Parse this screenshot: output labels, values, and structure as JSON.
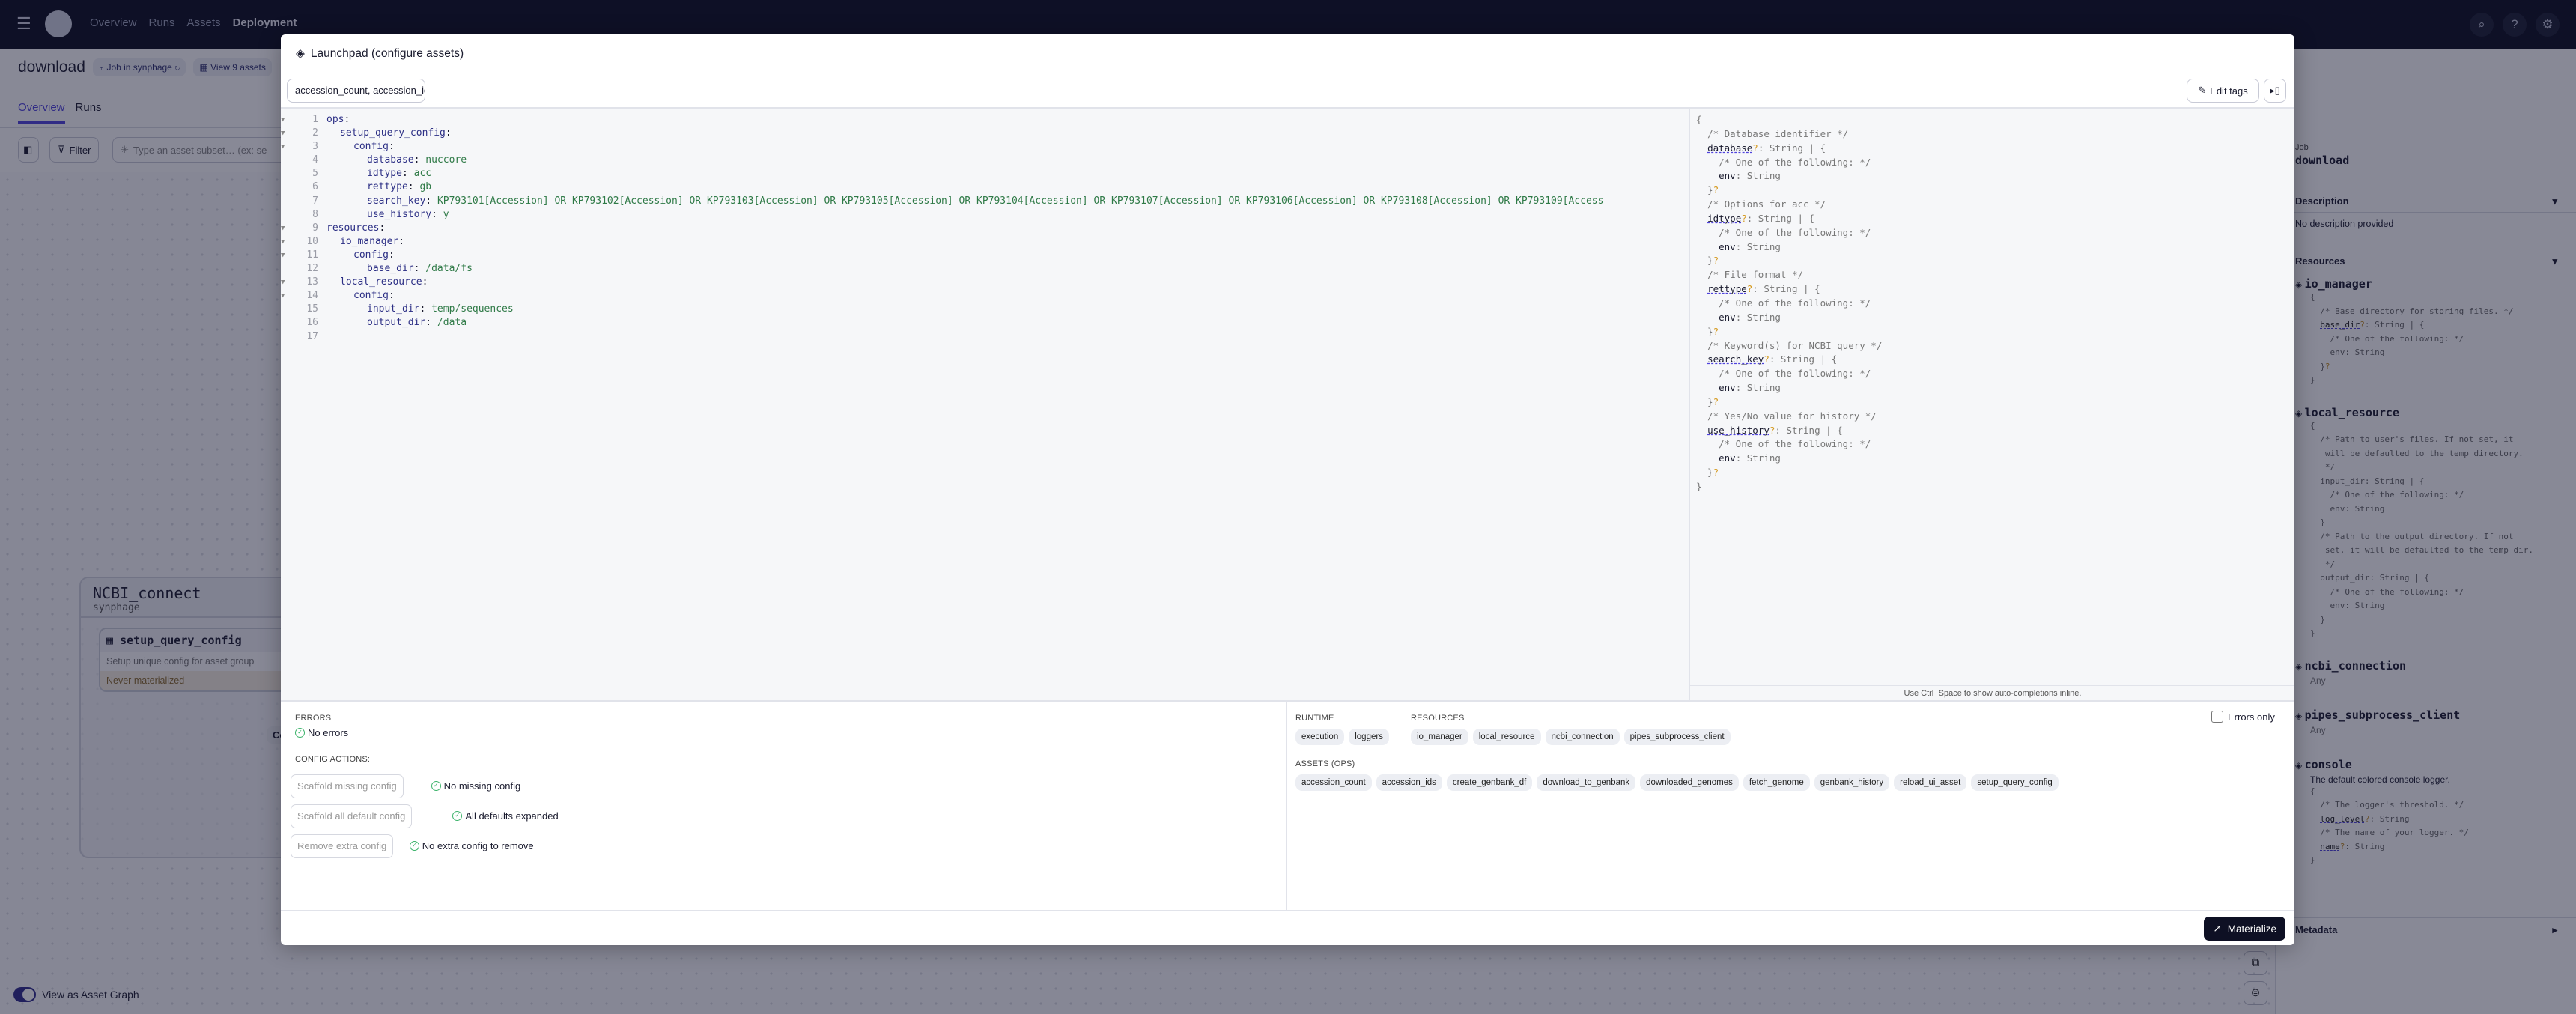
{
  "nav": {
    "items": [
      "Overview",
      "Runs",
      "Assets",
      "Deployment"
    ],
    "active": "Deployment"
  },
  "page": {
    "title": "download",
    "job_chip": "Job in synphage",
    "assets_chip": "View 9 assets",
    "tabs": [
      "Overview",
      "Runs"
    ],
    "filter_label": "Filter",
    "search_placeholder": "Type an asset subset… (ex: se",
    "group": {
      "name": "NCBI_connect",
      "location": "synphage"
    },
    "node": {
      "name": "setup_query_config",
      "description": "Setup unique config for asset group",
      "status": "Never materialized"
    },
    "partial_button": "Co",
    "toggle_label": "View as Asset Graph"
  },
  "sidebar": {
    "kind": "Job",
    "name": "download",
    "description_header": "Description",
    "description": "No description provided",
    "resources_header": "Resources",
    "metadata_header": "Metadata",
    "resources": [
      {
        "name": "io_manager",
        "body": [
          [
            "{"
          ],
          [
            "  ",
            [
              "/* Base directory for storing files. */"
            ]
          ],
          [
            "  ",
            [
              "base_dir",
              "k"
            ],
            [
              "?",
              "q"
            ],
            [
              ": String | {"
            ]
          ],
          [
            "    ",
            [
              "/* One of the following: */"
            ]
          ],
          [
            "    ",
            [
              "env",
              "e"
            ],
            [
              ": String"
            ]
          ],
          [
            "  }",
            [
              "?",
              "q"
            ]
          ],
          [
            "}"
          ]
        ]
      },
      {
        "name": "local_resource",
        "body": [
          [
            "{"
          ],
          [
            "  ",
            [
              "/* Path to user's files. If not set, it"
            ]
          ],
          [
            "   ",
            [
              "will be defaulted to the temp directory."
            ]
          ],
          [
            "   ",
            [
              "*/"
            ]
          ],
          [
            "  ",
            [
              "input_dir",
              "e"
            ],
            [
              ": String | {"
            ]
          ],
          [
            "    ",
            [
              "/* One of the following: */"
            ]
          ],
          [
            "    ",
            [
              "env",
              "e"
            ],
            [
              ": String"
            ]
          ],
          [
            "  }"
          ],
          [
            "  ",
            [
              "/* Path to the output directory. If not"
            ]
          ],
          [
            "   ",
            [
              "set, it will be defaulted to the temp dir."
            ]
          ],
          [
            "   ",
            [
              "*/"
            ]
          ],
          [
            "  ",
            [
              "output_dir",
              "e"
            ],
            [
              ": String | {"
            ]
          ],
          [
            "    ",
            [
              "/* One of the following: */"
            ]
          ],
          [
            "    ",
            [
              "env",
              "e"
            ],
            [
              ": String"
            ]
          ],
          [
            "  }"
          ],
          [
            "}"
          ]
        ]
      },
      {
        "name": "ncbi_connection",
        "type": "Any"
      },
      {
        "name": "pipes_subprocess_client",
        "type": "Any"
      },
      {
        "name": "console",
        "desc": "The default colored console logger.",
        "body": [
          [
            "{"
          ],
          [
            "  ",
            [
              "/* The logger's threshold. */"
            ]
          ],
          [
            "  ",
            [
              "log_level",
              "k"
            ],
            [
              "?",
              "q"
            ],
            [
              ": String"
            ]
          ],
          [
            "  ",
            [
              "/* The name of your logger. */"
            ]
          ],
          [
            "  ",
            [
              "name",
              "k"
            ],
            [
              "?",
              "q"
            ],
            [
              ": String"
            ]
          ],
          [
            "}"
          ]
        ]
      }
    ]
  },
  "modal": {
    "title": "Launchpad (configure assets)",
    "asset_selection": "accession_count, accession_ids",
    "edit_tags": "Edit tags",
    "code_lines": [
      {
        "n": "1",
        "fold": true,
        "ind": 0,
        "k": "ops",
        "v": ""
      },
      {
        "n": "2",
        "fold": true,
        "ind": 1,
        "k": "setup_query_config",
        "v": ""
      },
      {
        "n": "3",
        "fold": true,
        "ind": 2,
        "k": "config",
        "v": ""
      },
      {
        "n": "4",
        "ind": 3,
        "k": "database",
        "v": "nuccore"
      },
      {
        "n": "5",
        "ind": 3,
        "k": "idtype",
        "v": "acc"
      },
      {
        "n": "6",
        "ind": 3,
        "k": "rettype",
        "v": "gb"
      },
      {
        "n": "7",
        "ind": 3,
        "k": "search_key",
        "v": "KP793101[Accession] OR KP793102[Accession] OR KP793103[Accession] OR KP793105[Accession] OR KP793104[Accession] OR KP793107[Accession] OR KP793106[Accession] OR KP793108[Accession] OR KP793109[Access"
      },
      {
        "n": "8",
        "ind": 3,
        "k": "use_history",
        "v": "y"
      },
      {
        "n": "9",
        "fold": true,
        "ind": 0,
        "k": "resources",
        "v": ""
      },
      {
        "n": "10",
        "fold": true,
        "ind": 1,
        "k": "io_manager",
        "v": ""
      },
      {
        "n": "11",
        "fold": true,
        "ind": 2,
        "k": "config",
        "v": ""
      },
      {
        "n": "12",
        "ind": 3,
        "k": "base_dir",
        "v": "/data/fs"
      },
      {
        "n": "13",
        "fold": true,
        "ind": 1,
        "k": "local_resource",
        "v": ""
      },
      {
        "n": "14",
        "fold": true,
        "ind": 2,
        "k": "config",
        "v": ""
      },
      {
        "n": "15",
        "ind": 3,
        "k": "input_dir",
        "v": "temp/sequences"
      },
      {
        "n": "16",
        "ind": 3,
        "k": "output_dir",
        "v": "/data"
      },
      {
        "n": "17",
        "ind": 0,
        "k": "",
        "v": ""
      }
    ],
    "schema_lines": [
      [
        "{"
      ],
      [
        "  ",
        [
          "/* Database identifier */"
        ]
      ],
      [
        "  ",
        [
          "database",
          "k"
        ],
        [
          "?",
          "q"
        ],
        [
          ": String | {"
        ]
      ],
      [
        "    ",
        [
          "/* One of the following: */"
        ]
      ],
      [
        "    ",
        [
          "env",
          "e"
        ],
        [
          ": String"
        ]
      ],
      [
        "  }",
        [
          "?",
          "q"
        ]
      ],
      [
        "  ",
        [
          "/* Options for acc */"
        ]
      ],
      [
        "  ",
        [
          "idtype",
          "k"
        ],
        [
          "?",
          "q"
        ],
        [
          ": String | {"
        ]
      ],
      [
        "    ",
        [
          "/* One of the following: */"
        ]
      ],
      [
        "    ",
        [
          "env",
          "e"
        ],
        [
          ": String"
        ]
      ],
      [
        "  }",
        [
          "?",
          "q"
        ]
      ],
      [
        "  ",
        [
          "/* File format */"
        ]
      ],
      [
        "  ",
        [
          "rettype",
          "k"
        ],
        [
          "?",
          "q"
        ],
        [
          ": String | {"
        ]
      ],
      [
        "    ",
        [
          "/* One of the following: */"
        ]
      ],
      [
        "    ",
        [
          "env",
          "e"
        ],
        [
          ": String"
        ]
      ],
      [
        "  }",
        [
          "?",
          "q"
        ]
      ],
      [
        "  ",
        [
          "/* Keyword(s) for NCBI query */"
        ]
      ],
      [
        "  ",
        [
          "search_key",
          "k"
        ],
        [
          "?",
          "q"
        ],
        [
          ": String | {"
        ]
      ],
      [
        "    ",
        [
          "/* One of the following: */"
        ]
      ],
      [
        "    ",
        [
          "env",
          "e"
        ],
        [
          ": String"
        ]
      ],
      [
        "  }",
        [
          "?",
          "q"
        ]
      ],
      [
        "  ",
        [
          "/* Yes/No value for history */"
        ]
      ],
      [
        "  ",
        [
          "use_history",
          "k"
        ],
        [
          "?",
          "q"
        ],
        [
          ": String | {"
        ]
      ],
      [
        "    ",
        [
          "/* One of the following: */"
        ]
      ],
      [
        "    ",
        [
          "env",
          "e"
        ],
        [
          ": String"
        ]
      ],
      [
        "  }",
        [
          "?",
          "q"
        ]
      ],
      [
        "}"
      ]
    ],
    "hint": "Use Ctrl+Space to show auto-completions inline.",
    "errors_label": "ERRORS",
    "no_errors": "No errors",
    "config_actions_label": "CONFIG ACTIONS:",
    "actions": [
      {
        "button": "Scaffold missing config",
        "status": "No missing config"
      },
      {
        "button": "Scaffold all default config",
        "status": "All defaults expanded"
      },
      {
        "button": "Remove extra config",
        "status": "No extra config to remove"
      }
    ],
    "runtime_label": "RUNTIME",
    "runtime": [
      "execution",
      "loggers"
    ],
    "resources_label": "RESOURCES",
    "resources": [
      "io_manager",
      "local_resource",
      "ncbi_connection",
      "pipes_subprocess_client"
    ],
    "assets_label": "ASSETS (OPS)",
    "assets": [
      "accession_count",
      "accession_ids",
      "create_genbank_df",
      "download_to_genbank",
      "downloaded_genomes",
      "fetch_genome",
      "genbank_history",
      "reload_ui_asset",
      "setup_query_config"
    ],
    "errors_only": "Errors only",
    "errors_only_checked": false,
    "materialize": "Materialize"
  },
  "colors": {
    "nav_bg": "#0b0d1e",
    "accent": "#4f43dd",
    "materialize_bg": "#0e1024",
    "success": "#3bb36a",
    "code_key": "#2c2f85",
    "code_value": "#2f7a47"
  }
}
